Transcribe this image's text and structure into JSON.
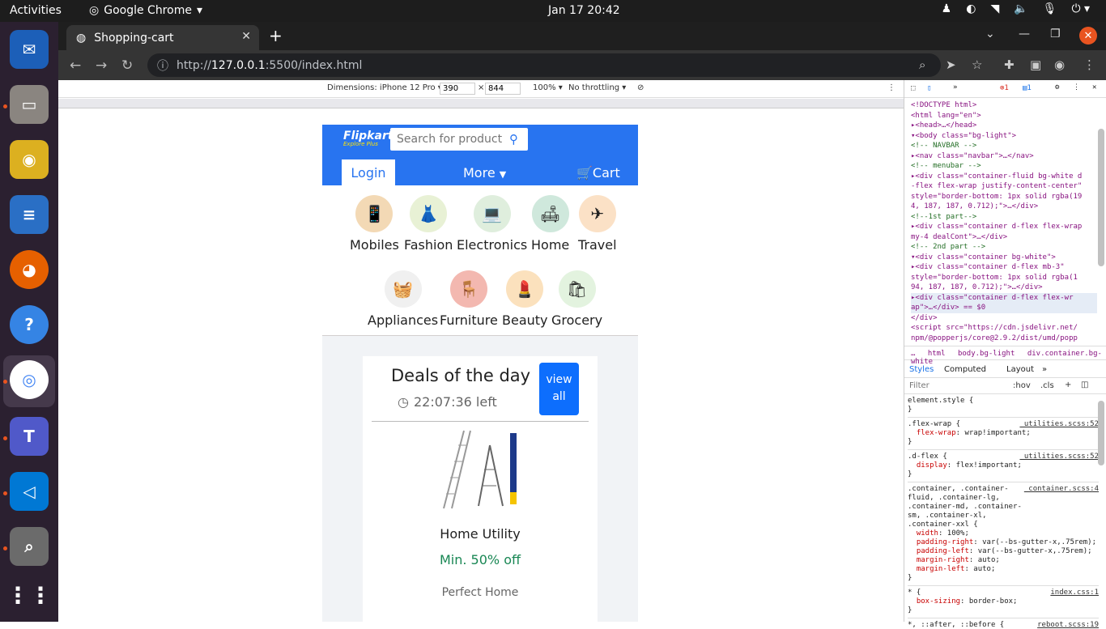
{
  "topbar": {
    "activities": "Activities",
    "app": "Google Chrome",
    "clock": "Jan 17  20:42"
  },
  "dock": {
    "icons": [
      "thunderbird-icon",
      "files-icon",
      "rhythmbox-icon",
      "writer-icon",
      "firefox-icon",
      "help-icon",
      "chrome-icon",
      "teams-icon",
      "vscode-icon",
      "screenshot-icon",
      "apps-grid-icon"
    ]
  },
  "browser": {
    "tab_title": "Shopping-cart",
    "url_prefix": "http://",
    "url_host": "127.0.0.1",
    "url_path": ":5500/index.html"
  },
  "device_bar": {
    "dimensions": "Dimensions: iPhone 12 Pro ▾",
    "width": "390",
    "height": "844",
    "zoom": "100% ▾",
    "throttle": "No throttling ▾"
  },
  "page": {
    "logo": "Flipkart",
    "logo_sub": "Explore Plus",
    "search_placeholder": "Search for products",
    "login": "Login",
    "more": "More",
    "cart": "Cart",
    "categories_row1": [
      "Mobiles",
      "Fashion",
      "Electronics",
      "Home",
      "Travel"
    ],
    "categories_row2": [
      "Appliances",
      "Furniture",
      "Beauty",
      "Grocery"
    ],
    "deal_title": "Deals of the day",
    "deal_timer": "22:07:36 left",
    "deal_button": "view all",
    "product_name": "Home Utility",
    "product_offer": "Min. 50% off",
    "product_tag": "Perfect Home"
  },
  "devtools": {
    "errors": "1",
    "messages": "1",
    "crumbs": [
      "html",
      "body.bg-light",
      "div.container.bg-white"
    ],
    "tabs": [
      "Styles",
      "Computed",
      "Layout"
    ],
    "filter": "Filter",
    "hov": ":hov",
    "cls": ".cls",
    "code_lines": [
      "<!DOCTYPE html>",
      "<html lang=\"en\">",
      "  ▸<head>…</head>",
      "  ▾<body class=\"bg-light\">",
      "    <!-- NAVBAR -->",
      "   ▸<nav class=\"navbar\">…</nav>",
      "    <!-- menubar -->",
      "   ▸<div class=\"container-fluid bg-white d",
      "   -flex flex-wrap justify-content-center\"",
      "   style=\"border-bottom: 1px solid rgba(19",
      "   4, 187, 187, 0.712);\">…</div>",
      "    <!--1st part-->",
      "   ▸<div class=\"container d-flex flex-wrap",
      "   my-4 dealCont\">…</div>",
      "    <!-- 2nd part -->",
      "   ▾<div class=\"container bg-white\">",
      "     ▸<div class=\"container d-flex mb-3\"",
      "     style=\"border-bottom: 1px solid rgba(1",
      "     94, 187, 187, 0.712);\">…</div>",
      "     ▸<div class=\"container d-flex flex-wr",
      "     ap\">…</div> == $0",
      "     </div>",
      "     <script src=\"https://cdn.jsdelivr.net/",
      "     npm/@popperjs/core@2.9.2/dist/umd/popp"
    ],
    "style_rules": [
      {
        "sel": "element.style {",
        "props": [],
        "file": ""
      },
      {
        "sel": ".flex-wrap {",
        "props": [
          "flex-wrap: wrap!important;"
        ],
        "file": "_utilities.scss:52"
      },
      {
        "sel": ".d-flex {",
        "props": [
          "display: flex!important;"
        ],
        "file": "_utilities.scss:52"
      },
      {
        "sel": ".container, .container-fluid, .container-lg, .container-md, .container-sm, .container-xl, .container-xxl {",
        "props": [
          "width: 100%;",
          "padding-right: var(--bs-gutter-x,.75rem);",
          "padding-left: var(--bs-gutter-x,.75rem);",
          "margin-right: auto;",
          "margin-left: auto;"
        ],
        "file": "_container.scss:4"
      },
      {
        "sel": "* {",
        "props": [
          "box-sizing: border-box;"
        ],
        "file": "index.css:1"
      },
      {
        "sel": "*, ::after, ::before {",
        "props": [],
        "file": "reboot.scss:19"
      }
    ]
  },
  "colors": {
    "flipkart_blue": "#2874f0",
    "deal_button": "#0d6efd",
    "offer_green": "#198754"
  }
}
